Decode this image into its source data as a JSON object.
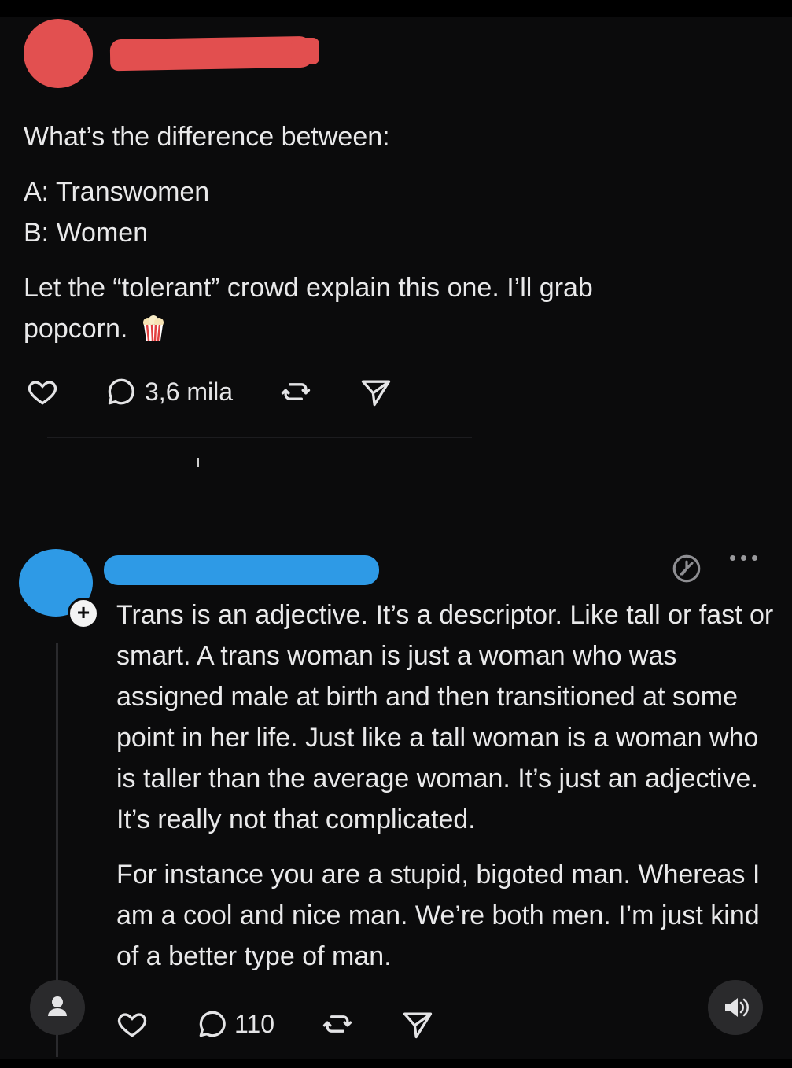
{
  "post": {
    "lines": [
      "What’s the difference between:",
      "A: Transwomen",
      "B: Women",
      "Let the “tolerant” crowd explain this one. I’ll grab",
      "popcorn."
    ],
    "reply_count": "3,6 mila"
  },
  "reply": {
    "paragraph1": "Trans is an adjective. It’s a descriptor. Like tall or fast or smart. A trans woman is just a woman who was assigned male at birth and then transitioned at some point in her life. Just like a tall woman is a woman who is taller than the average woman. It’s just an adjective. It’s really not that complicated.",
    "paragraph2": "For instance you are a stupid, bigoted man. Whereas I am a cool and nice man. We’re both men. I’m just kind of a better type of man.",
    "reply_count": "110"
  },
  "colors": {
    "background": "#0b0b0c",
    "text": "#e9e9ea",
    "redact_red": "#e24f4f",
    "redact_blue": "#2e9ae6"
  },
  "icons": [
    "like-icon",
    "comment-icon",
    "repost-icon",
    "share-icon",
    "popcorn-icon",
    "clock-icon",
    "more-icon",
    "user-icon",
    "volume-icon"
  ]
}
